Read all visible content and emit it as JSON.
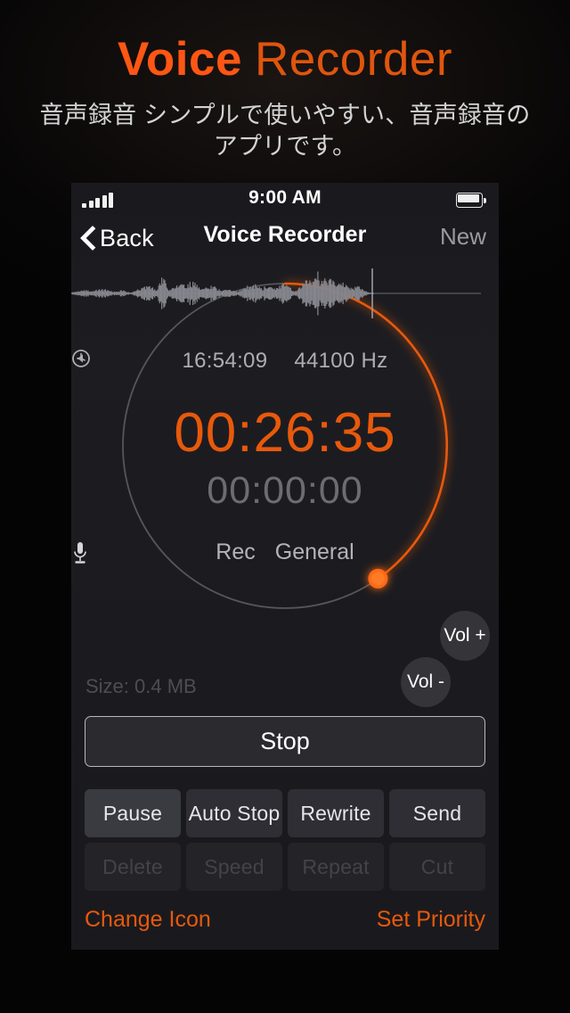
{
  "promo": {
    "title_word1": "Voice",
    "title_word2": "Recorder",
    "subtitle": "音声録音 シンプルで使いやすい、音声録音のアプリです。"
  },
  "colors": {
    "accent_orange": "#e8590c",
    "title_orange": "#ff5614",
    "screen_bg": "#1b1b1f",
    "page_bg": "#050505"
  },
  "statusbar": {
    "time": "9:00 AM",
    "signal_bars": 5,
    "battery_level": "full"
  },
  "navbar": {
    "back_label": "Back",
    "title": "Voice Recorder",
    "new_label": "New"
  },
  "dial": {
    "elapsed_clock": "16:54:09",
    "sample_rate": "44100 Hz",
    "main_timer": "00:26:35",
    "secondary_timer": "00:00:00",
    "mode_label": "Rec",
    "profile_label": "General",
    "progress_percent": 40
  },
  "volume": {
    "up_label": "Vol +",
    "down_label": "Vol -"
  },
  "file": {
    "size_label": "Size: 0.4 MB"
  },
  "transport": {
    "stop_label": "Stop"
  },
  "grid": {
    "row1": [
      {
        "label": "Pause",
        "state": "on"
      },
      {
        "label": "Auto Stop",
        "state": "on dim"
      },
      {
        "label": "Rewrite",
        "state": "on dim"
      },
      {
        "label": "Send",
        "state": "on dim"
      }
    ],
    "row2": [
      {
        "label": "Delete",
        "state": "off"
      },
      {
        "label": "Speed",
        "state": "off"
      },
      {
        "label": "Repeat",
        "state": "off"
      },
      {
        "label": "Cut",
        "state": "off"
      }
    ]
  },
  "footer": {
    "change_icon_label": "Change Icon",
    "set_priority_label": "Set Priority"
  },
  "icons": {
    "clock": "clock-icon",
    "speaker": "speaker-icon",
    "microphone": "microphone-icon",
    "back_chevron": "chevron-left-icon",
    "signal": "signal-bars-icon",
    "battery": "battery-icon"
  }
}
